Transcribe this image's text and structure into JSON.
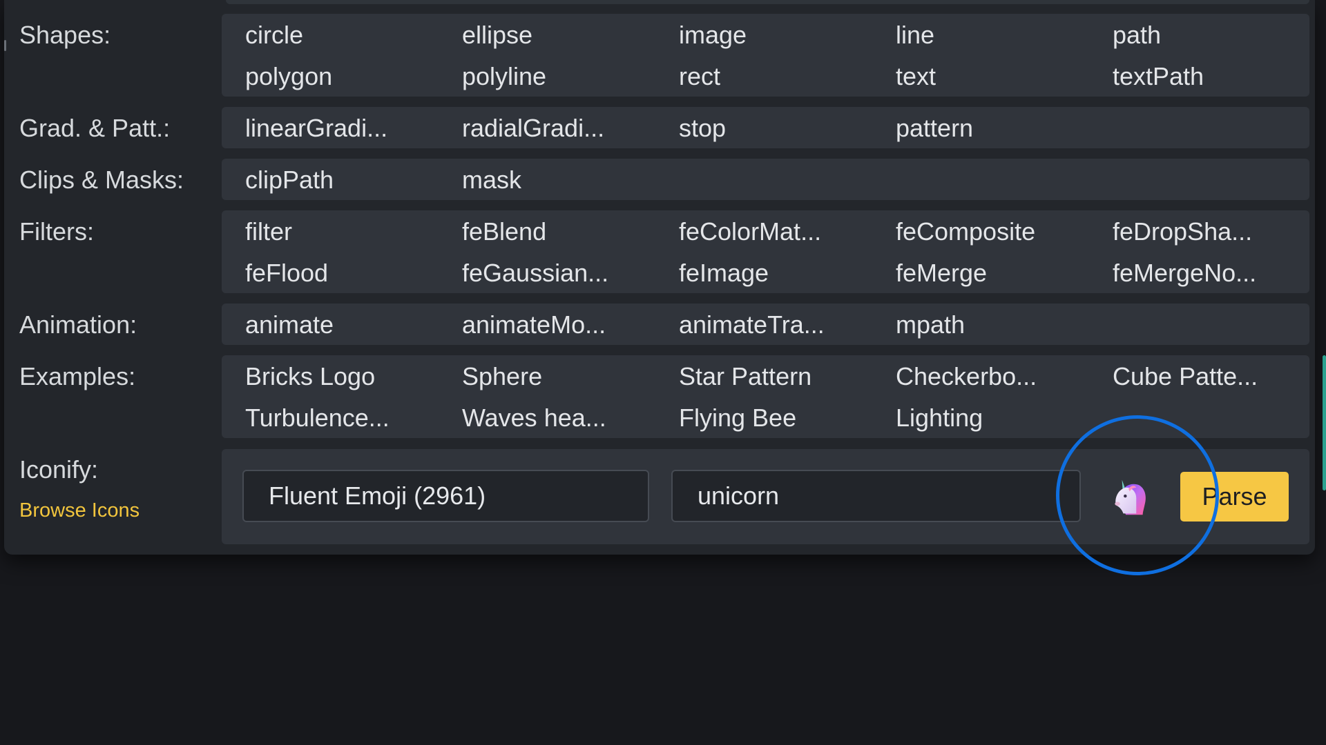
{
  "rows": {
    "shapes": {
      "label": "Shapes:",
      "items": [
        "circle",
        "ellipse",
        "image",
        "line",
        "path",
        "polygon",
        "polyline",
        "rect",
        "text",
        "textPath"
      ]
    },
    "gradients": {
      "label": "Grad. & Patt.:",
      "items": [
        "linearGradi...",
        "radialGradi...",
        "stop",
        "pattern"
      ]
    },
    "clips": {
      "label": "Clips & Masks:",
      "items": [
        "clipPath",
        "mask"
      ]
    },
    "filters": {
      "label": "Filters:",
      "items": [
        "filter",
        "feBlend",
        "feColorMat...",
        "feComposite",
        "feDropSha...",
        "feFlood",
        "feGaussian...",
        "feImage",
        "feMerge",
        "feMergeNo..."
      ]
    },
    "animation": {
      "label": "Animation:",
      "items": [
        "animate",
        "animateMo...",
        "animateTra...",
        "mpath"
      ]
    },
    "examples": {
      "label": "Examples:",
      "items": [
        "Bricks Logo",
        "Sphere",
        "Star Pattern",
        "Checkerbo...",
        "Cube Patte...",
        "Turbulence...",
        "Waves hea...",
        "Flying Bee",
        "Lighting"
      ]
    }
  },
  "iconify": {
    "label": "Iconify:",
    "browse_label": "Browse Icons",
    "collection_value": "Fluent Emoji (2961)",
    "search_value": "unicorn",
    "preview_icon": "unicorn-icon",
    "parse_label": "Parse"
  },
  "colors": {
    "accent": "#f6c744",
    "link": "#f2c53d",
    "focus_ring": "#0f6fe0",
    "scrollbar": "#2aa18f"
  }
}
